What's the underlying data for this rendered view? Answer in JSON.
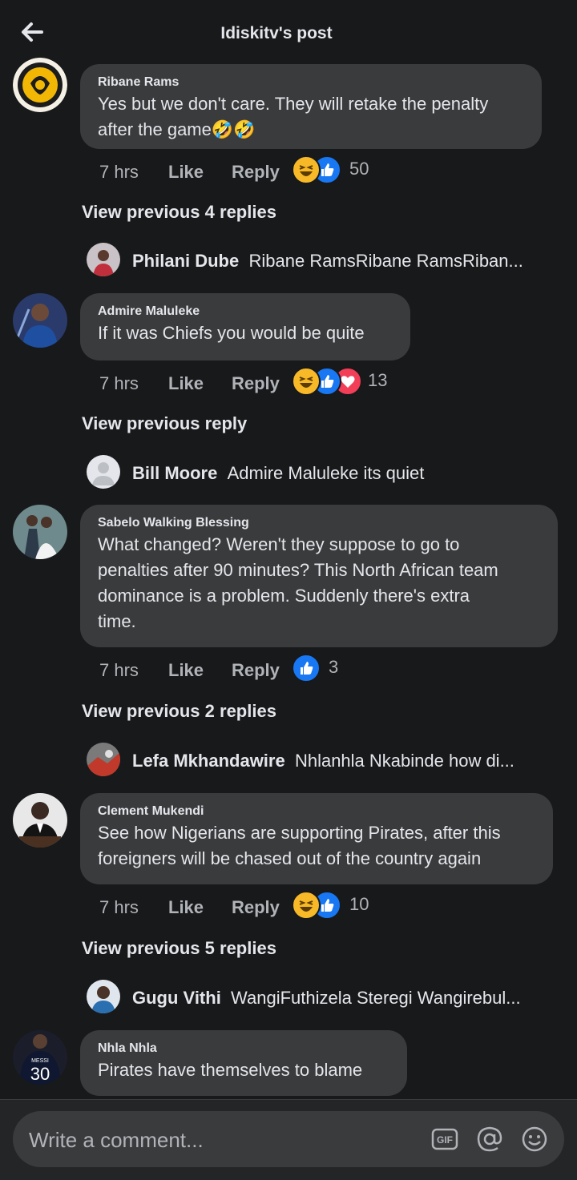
{
  "header": {
    "title": "Idiskitv's post"
  },
  "comments": [
    {
      "author": "Ribane Rams",
      "text_line1": "Yes but we don't care. They will retake the penalty",
      "text_line2": "after the game🤣🤣",
      "time": "7 hrs",
      "like": "Like",
      "reply": "Reply",
      "reactions": [
        "haha",
        "like"
      ],
      "count": "50",
      "view_replies": "View previous 4 replies",
      "reply_preview": {
        "author": "Philani Dube",
        "text": "Ribane RamsRibane RamsRiban..."
      }
    },
    {
      "author": "Admire Maluleke",
      "text_line1": "If it was Chiefs you would be quite",
      "time": "7 hrs",
      "like": "Like",
      "reply": "Reply",
      "reactions": [
        "haha",
        "like",
        "love"
      ],
      "count": "13",
      "view_replies": "View previous reply",
      "reply_preview": {
        "author": "Bill Moore",
        "text": "Admire Maluleke its quiet"
      }
    },
    {
      "author": "Sabelo Walking Blessing",
      "text_line1": "What changed? Weren't they suppose to go to",
      "text_line2": "penalties after 90 minutes? This North African team",
      "text_line3": "dominance is a problem. Suddenly there's extra",
      "text_line4": "time.",
      "time": "7 hrs",
      "like": "Like",
      "reply": "Reply",
      "reactions": [
        "like"
      ],
      "count": "3",
      "view_replies": "View previous 2 replies",
      "reply_preview": {
        "author": "Lefa Mkhandawire",
        "text": "Nhlanhla Nkabinde how di..."
      }
    },
    {
      "author": "Clement Mukendi",
      "text_line1": "See how Nigerians are supporting Pirates, after this",
      "text_line2": "foreigners will be chased out of the country again",
      "time": "7 hrs",
      "like": "Like",
      "reply": "Reply",
      "reactions": [
        "haha",
        "like"
      ],
      "count": "10",
      "view_replies": "View previous 5 replies",
      "reply_preview": {
        "author": "Gugu Vithi",
        "text": "WangiFuthizela Steregi Wangirebul..."
      }
    },
    {
      "author": "Nhla Nhla",
      "text_line1": "Pirates have themselves to blame",
      "avatar_jersey_name": "MESSI",
      "avatar_jersey_number": "30"
    }
  ],
  "composer": {
    "placeholder": "Write a comment...",
    "icons": [
      "gif-icon",
      "mention-icon",
      "emoji-icon"
    ],
    "gif_label": "GIF"
  },
  "colors": {
    "background": "#18191a",
    "bubble": "#3a3b3c",
    "muted_text": "#b0b3b8",
    "like_blue": "#1877f2",
    "haha_yellow": "#f7b928",
    "love_red": "#f33e58"
  }
}
